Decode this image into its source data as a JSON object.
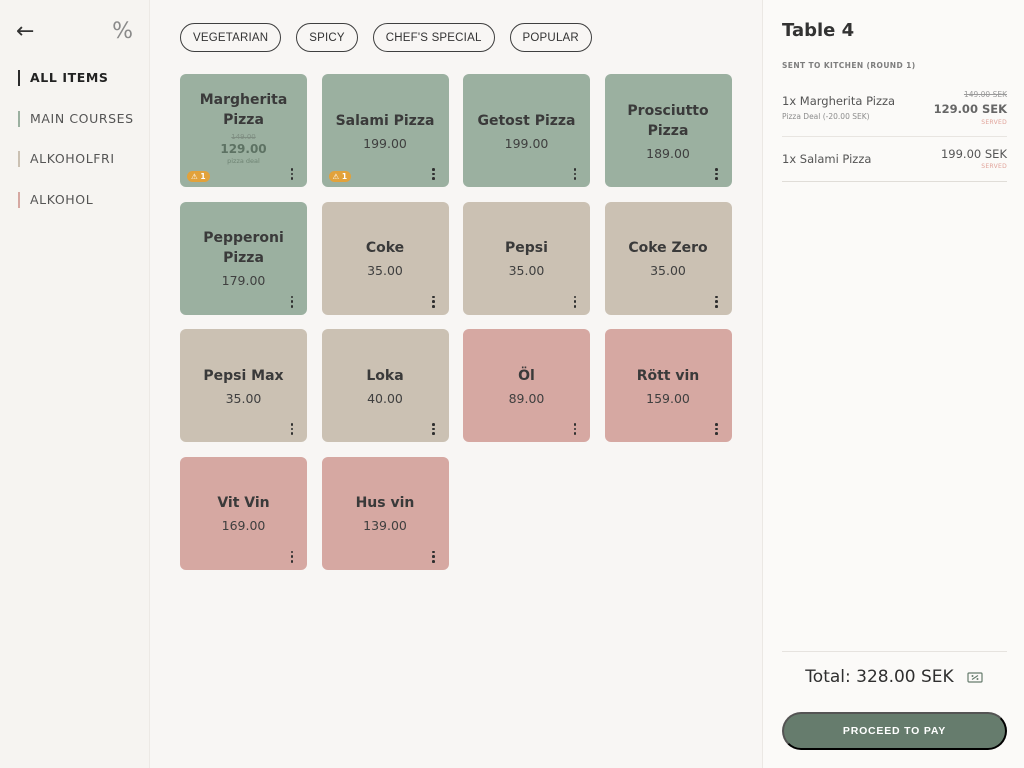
{
  "sidebar": {
    "back_icon": "←",
    "discount_icon": "%",
    "categories": [
      {
        "label": "ALL ITEMS",
        "color": "#2b2b2b",
        "active": true
      },
      {
        "label": "MAIN COURSES",
        "color": "#9bb0a0",
        "active": false
      },
      {
        "label": "ALKOHOLFRI",
        "color": "#cbc1b3",
        "active": false
      },
      {
        "label": "ALKOHOL",
        "color": "#d6a8a2",
        "active": false
      }
    ]
  },
  "filters": [
    {
      "label": "VEGETARIAN"
    },
    {
      "label": "SPICY"
    },
    {
      "label": "CHEF'S SPECIAL"
    },
    {
      "label": "POPULAR"
    }
  ],
  "products": [
    {
      "name": "Margherita Pizza",
      "price": "149.00",
      "new_price": "129.00",
      "deal": "pizza deal",
      "category": "green",
      "badge": "⚠ 1"
    },
    {
      "name": "Salami Pizza",
      "price": "199.00",
      "category": "green",
      "badge": "⚠ 1"
    },
    {
      "name": "Getost Pizza",
      "price": "199.00",
      "category": "green"
    },
    {
      "name": "Prosciutto Pizza",
      "price": "189.00",
      "category": "green"
    },
    {
      "name": "Pepperoni Pizza",
      "price": "179.00",
      "category": "green"
    },
    {
      "name": "Coke",
      "price": "35.00",
      "category": "beige"
    },
    {
      "name": "Pepsi",
      "price": "35.00",
      "category": "beige"
    },
    {
      "name": "Coke Zero",
      "price": "35.00",
      "category": "beige"
    },
    {
      "name": "Pepsi Max",
      "price": "35.00",
      "category": "beige"
    },
    {
      "name": "Loka",
      "price": "40.00",
      "category": "beige"
    },
    {
      "name": "Öl",
      "price": "89.00",
      "category": "pink"
    },
    {
      "name": "Rött vin",
      "price": "159.00",
      "category": "pink"
    },
    {
      "name": "Vit Vin",
      "price": "169.00",
      "category": "pink"
    },
    {
      "name": "Hus vin",
      "price": "139.00",
      "category": "pink"
    }
  ],
  "order": {
    "title": "Table 4",
    "round_label": "SENT TO KITCHEN (ROUND 1)",
    "lines": [
      {
        "name": "1x Margherita Pizza",
        "sub": "Pizza Deal (-20.00 SEK)",
        "old_price": "149.00 SEK",
        "price": "129.00 SEK",
        "status": "SERVED"
      },
      {
        "name": "1x Salami Pizza",
        "price": "199.00 SEK",
        "status": "SERVED"
      }
    ],
    "total": "Total: 328.00 SEK",
    "pay_label": "PROCEED TO PAY",
    "voucher_icon": "voucher-icon"
  },
  "colors": {
    "main_courses": "#9bb0a0",
    "alkoholfri": "#cbc1b3",
    "alkohol": "#d6a8a2",
    "accent": "#667c6d",
    "warning": "#e2a23b"
  }
}
